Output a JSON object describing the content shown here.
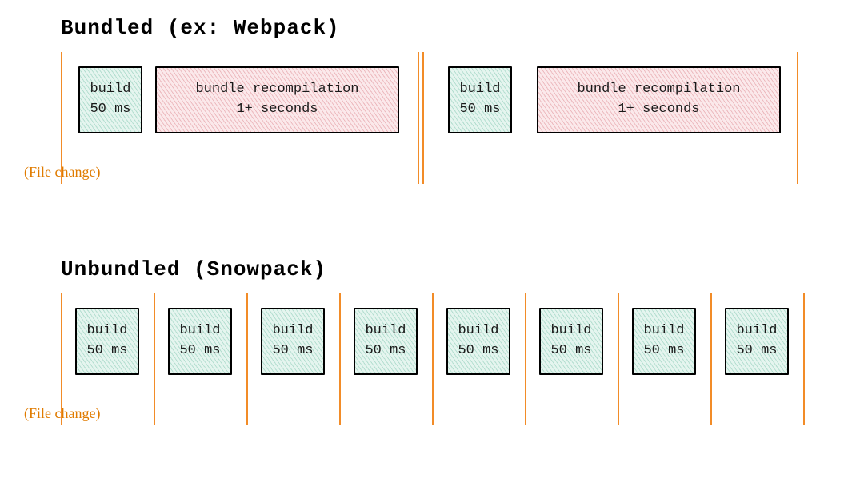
{
  "bundled": {
    "title": "Bundled (ex: Webpack)",
    "file_change_label": "(File change)",
    "build_label_line1": "build",
    "build_label_line2": "50 ms",
    "bundle_label_line1": "bundle recompilation",
    "bundle_label_line2": "1+ seconds"
  },
  "unbundled": {
    "title": "Unbundled (Snowpack)",
    "file_change_label": "(File change)",
    "build_label_line1": "build",
    "build_label_line2": "50 ms"
  },
  "colors": {
    "divider": "#f28c28",
    "build_fill": "rgba(190,230,215,0.4)",
    "bundle_fill": "rgba(245,200,205,0.4)"
  }
}
